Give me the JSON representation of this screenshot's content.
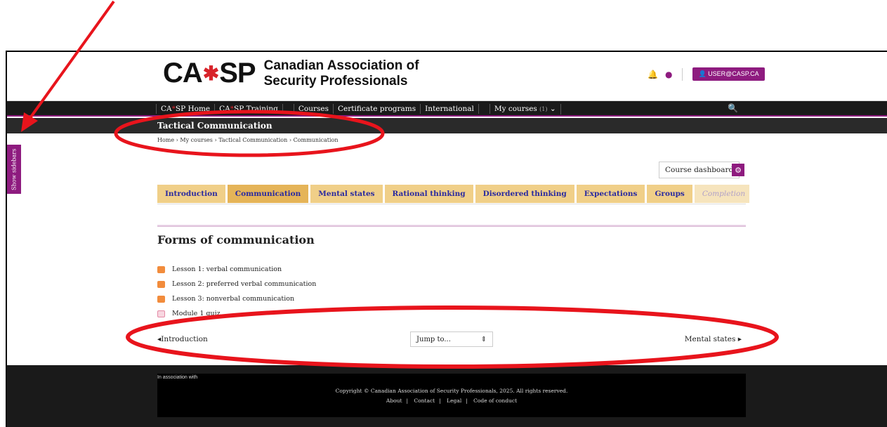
{
  "header": {
    "logo_left": "CA",
    "logo_right": "SP",
    "org_line1": "Canadian Association of",
    "org_line2": "Security Professionals",
    "user_label": "USER@CASP.CA"
  },
  "nav": {
    "home_prefix": "CA",
    "home_suffix": "SP Home",
    "training_prefix": "CA",
    "training_suffix": "SP Training",
    "courses": "Courses",
    "certificates": "Certificate programs",
    "international": "International",
    "my_courses": "My courses",
    "my_courses_count": "(1)"
  },
  "course": {
    "title": "Tactical Communication",
    "breadcrumb": [
      "Home",
      "My courses",
      "Tactical Communication",
      "Communication"
    ]
  },
  "sidebar_toggle": "Show sidebars",
  "dashboard_label": "Course dashboard",
  "tabs": [
    {
      "label": "Introduction"
    },
    {
      "label": "Communication"
    },
    {
      "label": "Mental states"
    },
    {
      "label": "Rational thinking"
    },
    {
      "label": "Disordered thinking"
    },
    {
      "label": "Expectations"
    },
    {
      "label": "Groups"
    },
    {
      "label": "Completion"
    }
  ],
  "section": {
    "title": "Forms of communication",
    "activities": [
      {
        "label": "Lesson 1: verbal communication"
      },
      {
        "label": "Lesson 2: preferred verbal communication"
      },
      {
        "label": "Lesson 3: nonverbal communication"
      },
      {
        "label": "Module 1 quiz"
      }
    ]
  },
  "pager": {
    "prev": "Introduction",
    "jump": "Jump to...",
    "next": "Mental states"
  },
  "footer": {
    "assoc": "In association with",
    "copyright": "Copyright © Canadian Association of Security Professionals, 2025. All rights reserved.",
    "links": [
      "About",
      "Contact",
      "Legal",
      "Code of conduct"
    ]
  },
  "colors": {
    "brand": "#8e1b7f",
    "maple": "#d8232a",
    "tab": "#f0cf88",
    "tab_active": "#e5b458",
    "annotation": "#e8141c"
  }
}
